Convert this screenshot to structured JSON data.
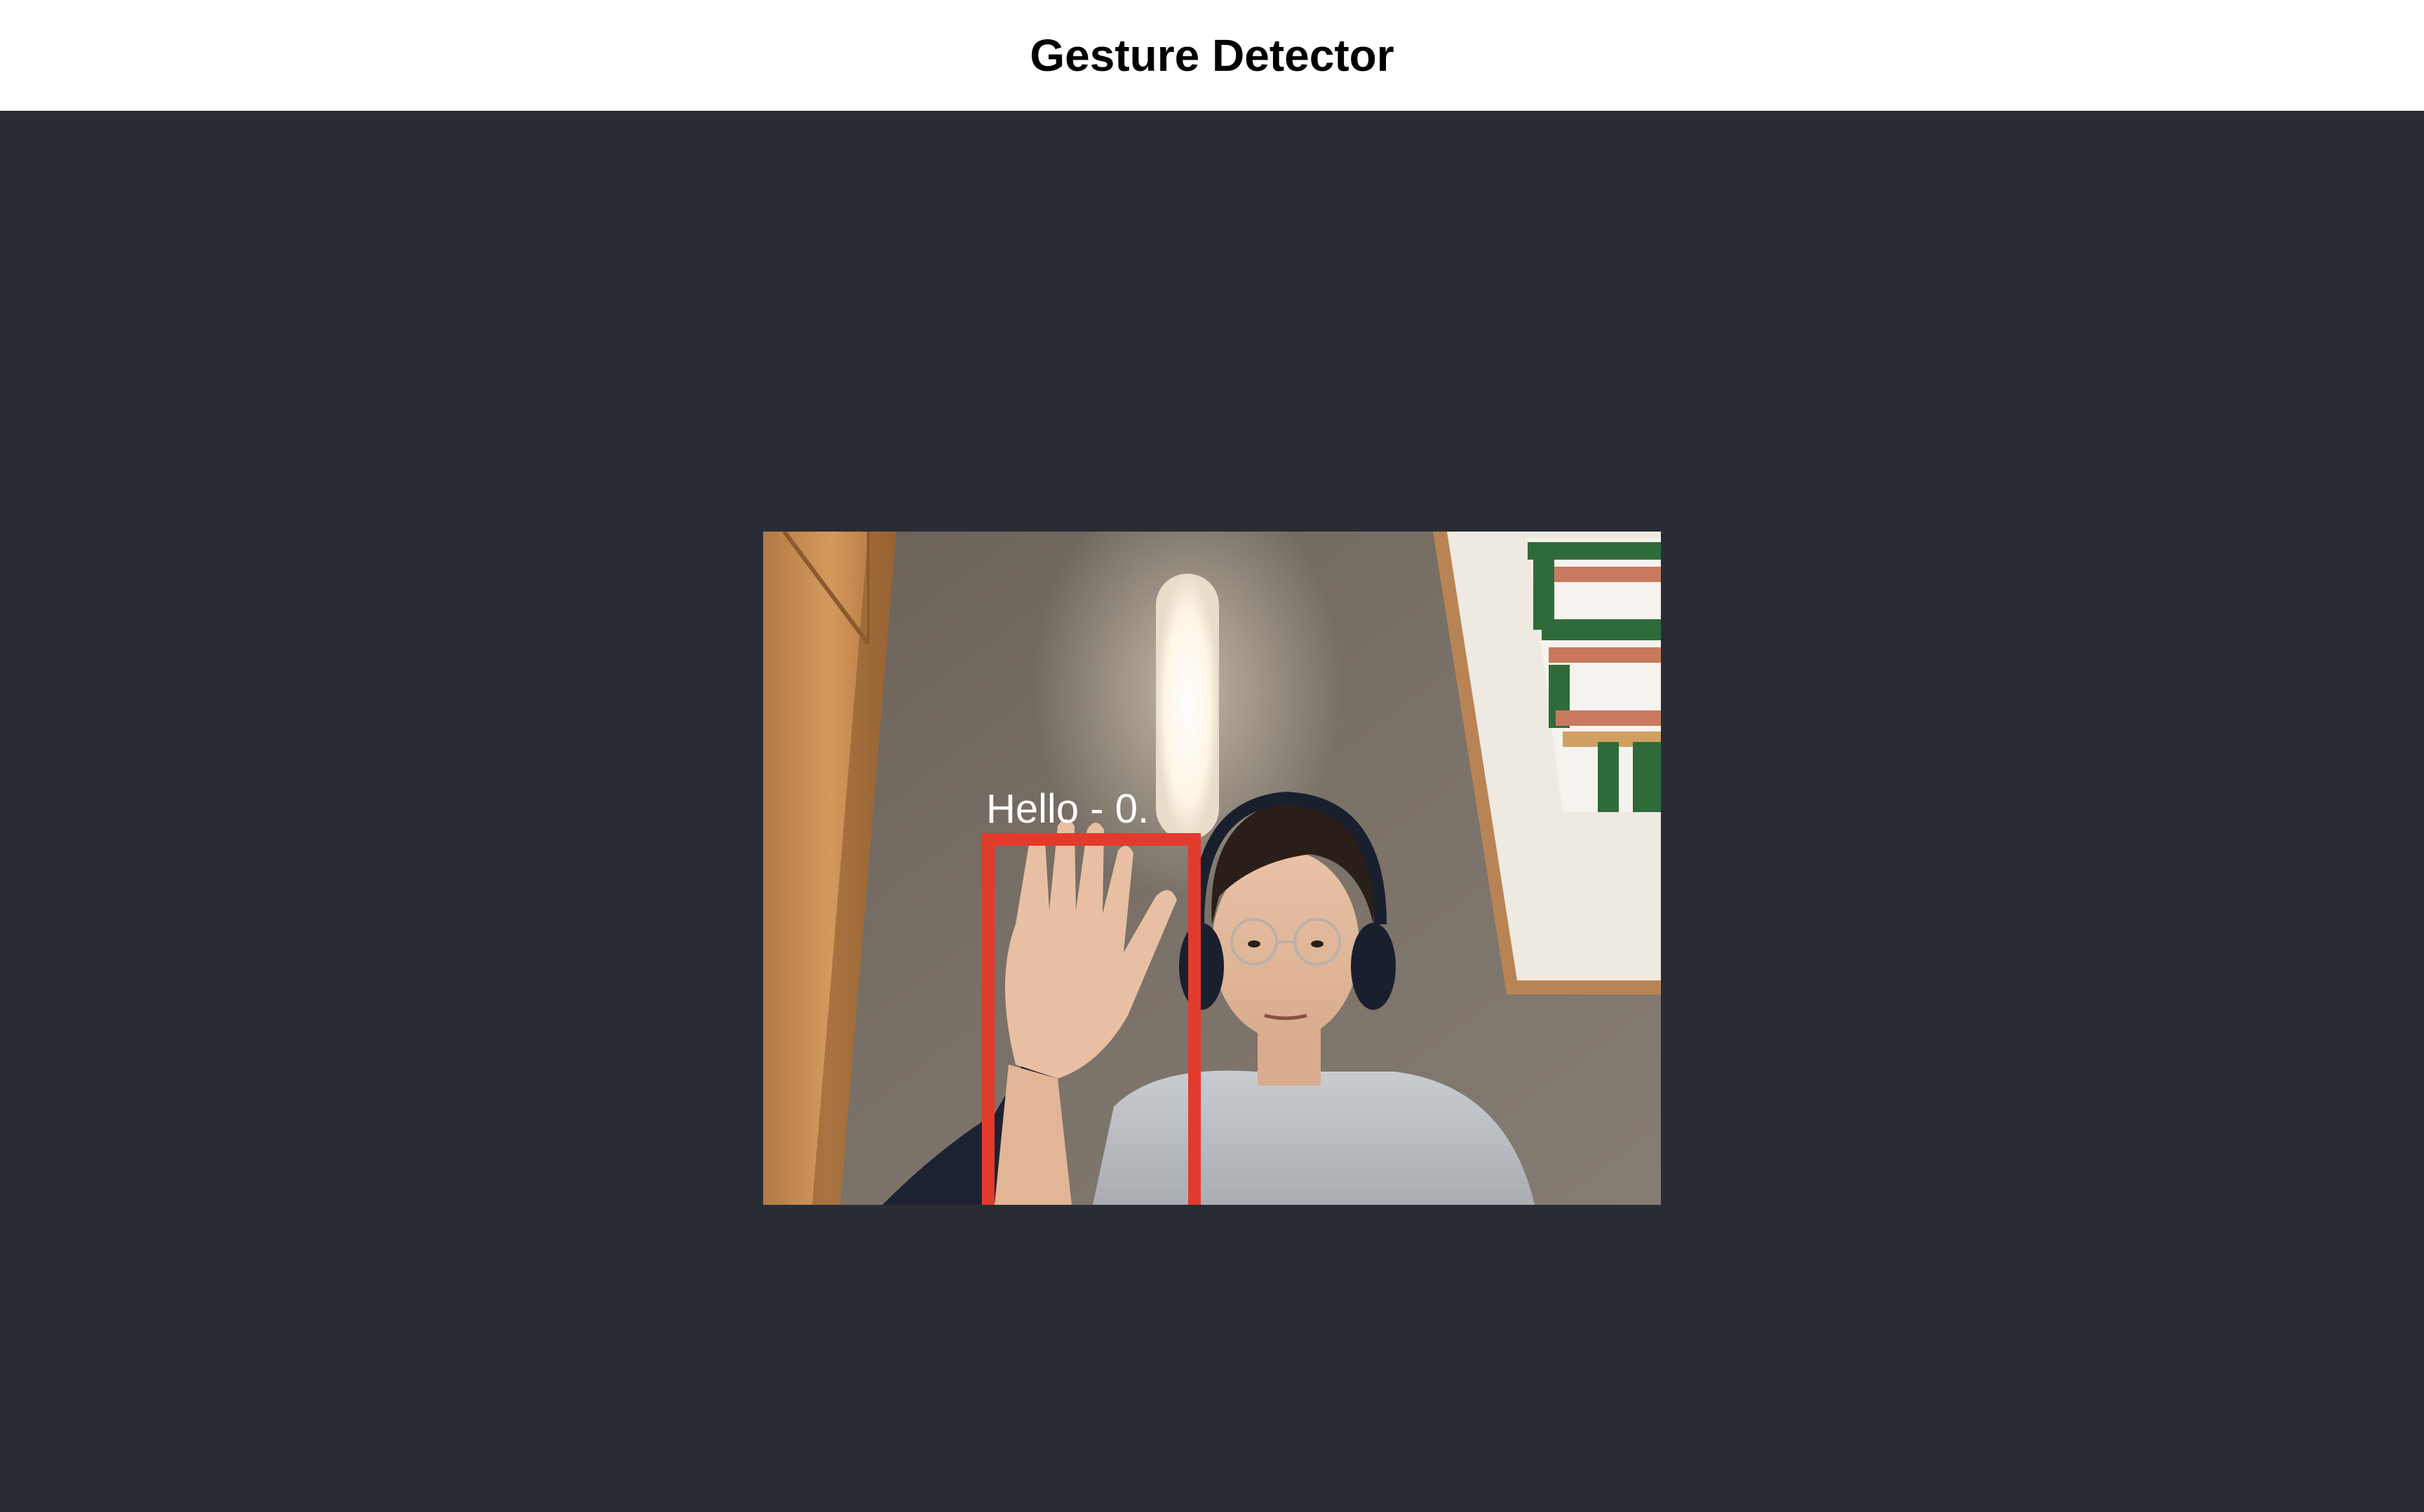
{
  "header": {
    "title": "Gesture Detector"
  },
  "detection": {
    "label": "Hello - 0.",
    "box_color": "#e23b2c",
    "gesture": "Hello"
  },
  "colors": {
    "background": "#292c35",
    "header_bg": "#ffffff",
    "title_text": "#000000"
  },
  "icons": {
    "video_feed": "webcam-feed"
  }
}
